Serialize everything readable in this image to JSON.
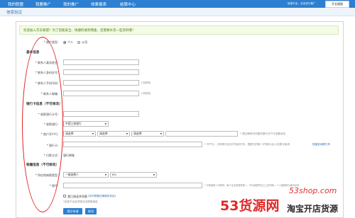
{
  "topnav": {
    "items": [
      "我的联盟",
      "我要推广",
      "我的推广",
      "效果报表",
      "结算中心"
    ],
    "warning": "信息不全，无法进行推广",
    "login_button": "开金猫猫"
  },
  "page_title": "信息验证",
  "welcome": "欢迎加入京东联盟！为了您能安全、快捷的收到佣金，还需要补充一些资料哦！",
  "account_type": {
    "label": "* 账户类型：",
    "options": [
      "个人",
      "公司"
    ],
    "selected": "个人"
  },
  "basic_info": {
    "title": "基本信息",
    "fields": [
      {
        "label": "* 联系人真实姓名：",
        "value": "",
        "hint": ""
      },
      {
        "label": "* 联系人身份证号：",
        "value": "",
        "hint": ""
      },
      {
        "label": "* 联系人手机号码：",
        "value": "",
        "hint": "(可修改)"
      },
      {
        "label": "* 联系人邮箱：",
        "value": "",
        "hint": "(可修改)"
      }
    ]
  },
  "bank_info": {
    "title": "银行卡信息（不可修改）",
    "card_holder_label": "* 收款银行卡号：",
    "bank_label": "* 收款银行：",
    "bank_value": "中国工商银行",
    "branch_label": "* 账户开户行：",
    "branch_selects": [
      "请选择",
      "请选择",
      "请选择"
    ],
    "branch_hint": "* 请正确填写完整的银行开户行准备地址",
    "card_no_label": "* 银行卡：",
    "card_no_hint": "* 开户行，又称现代化支付系统行号，是银行的唯一识别码 由12位数字组成",
    "card_no_link": "快速查询联行号",
    "pay_type_label": "* 付款方式：",
    "pay_type_value": "银行转账"
  },
  "tax_info": {
    "title": "税籍信息（不可修改）",
    "taxpayer_label": "* 所在地纳税类型：",
    "taxpayer_value": "一般纳税人",
    "rate_value": "6%",
    "tax_no_label": "* 税号：",
    "tax_no_hint": "* 又称纳税人识别号，每个企业的税号唯一，作为纳税凭证之上的号码；个人纳税即为身份证号"
  },
  "agreement": {
    "prefix": "我已阅读并同意",
    "link": "《京东联盟法律服务协议》"
  },
  "note": "*信息不全会导致无法提取佣金",
  "buttons": {
    "submit": "提交申请",
    "cancel": "取消"
  },
  "watermark": {
    "url": "53shop.com",
    "brand": "53货源网",
    "tagline": "淘宝开店货源"
  },
  "colors": {
    "nav": "#2d7fd1",
    "annotation": "#e02020"
  }
}
